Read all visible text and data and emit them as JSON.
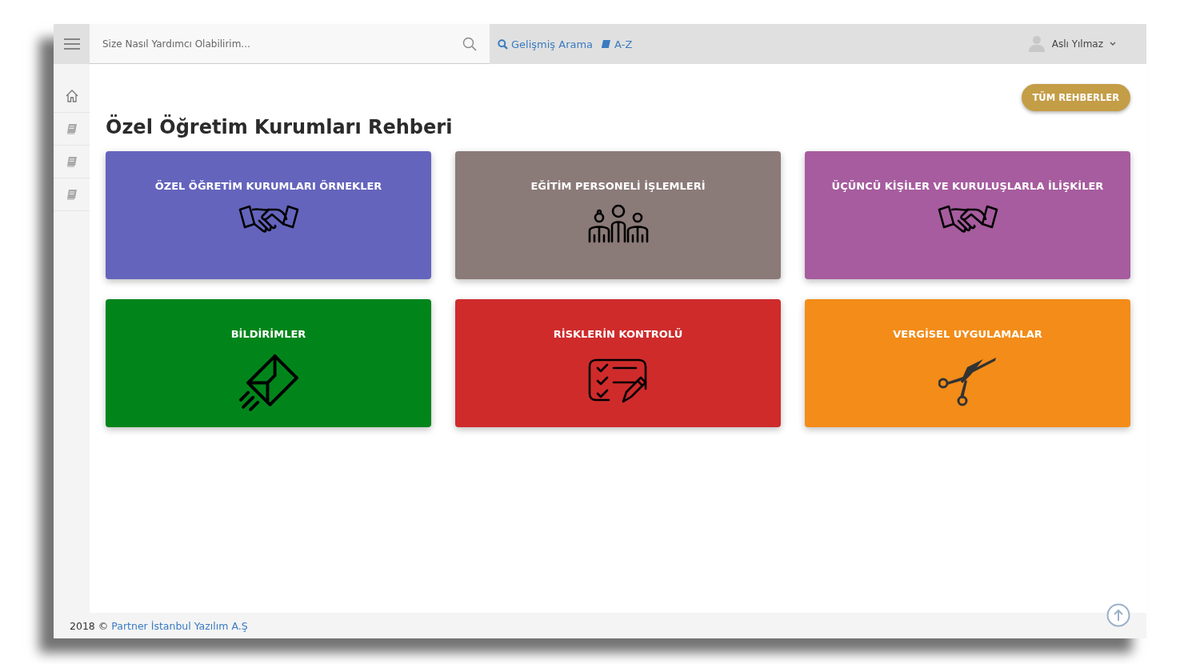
{
  "header": {
    "search": {
      "placeholder": "Size Nasıl Yardımcı Olabilirim..."
    },
    "links": [
      "Gelişmiş Arama",
      "A-Z"
    ],
    "user": "Aslı Yılmaz"
  },
  "button": "TÜM REHBERLER",
  "title": "Özel Öğretim Kurumları Rehberi",
  "cards": [
    {
      "label": "ÖZEL ÖĞRETİM KURUMLARI ÖRNEKLER",
      "color": "#6464bd"
    },
    {
      "label": "EĞİTİM PERSONELİ İŞLEMLERİ",
      "color": "#8a7a78"
    },
    {
      "label": "ÜÇÜNCÜ KİŞİLER VE KURULUŞLARLA İLİŞKİLER",
      "color": "#a65c9e"
    },
    {
      "label": "BİLDİRİMLER",
      "color": "#01851b"
    },
    {
      "label": "RİSKLERİN KONTROLÜ",
      "color": "#cf2b2b"
    },
    {
      "label": "VERGİSEL UYGULAMALAR",
      "color": "#f38c18"
    }
  ],
  "footer": {
    "copyright": "2018 ©",
    "company": "Partner İstanbul Yazılım A.Ş"
  }
}
